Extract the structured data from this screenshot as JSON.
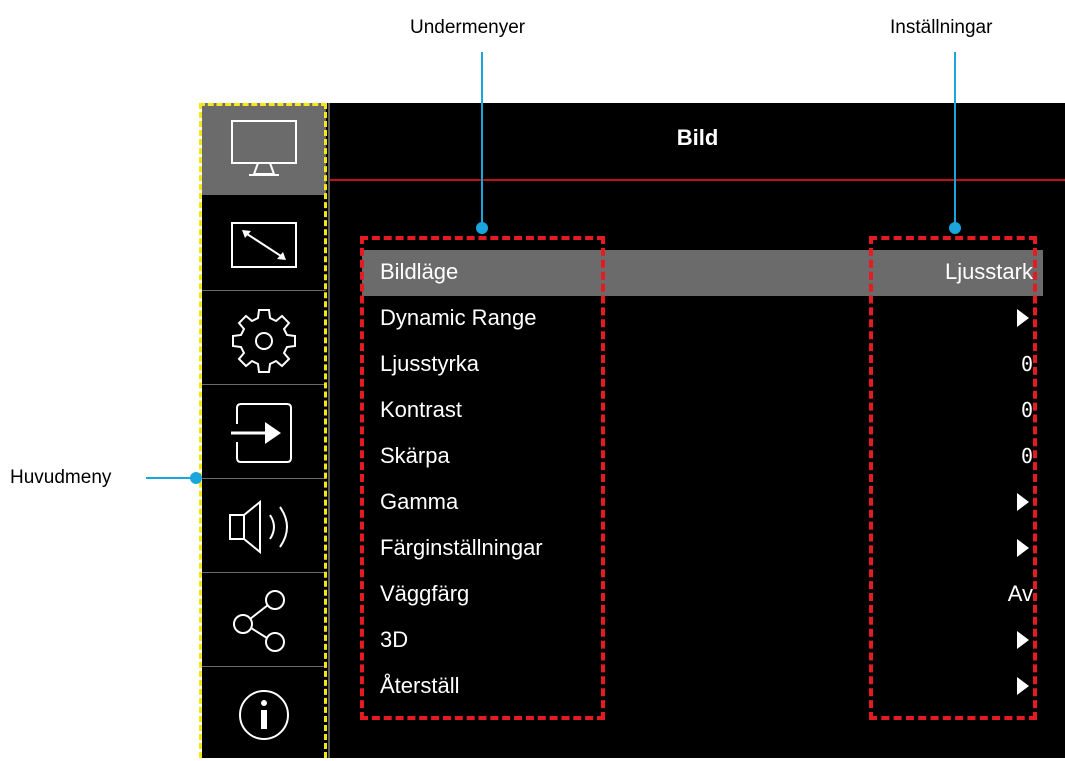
{
  "callouts": {
    "submenus": "Undermenyer",
    "settings": "Inställningar",
    "main_menu": "Huvudmeny"
  },
  "colors": {
    "callout": "#1aa6dc",
    "main_frame": "#f5e616",
    "group_frame": "#e51b23",
    "header_line": "#c0101a",
    "selected_row": "#6b6b6b"
  },
  "sidebar": {
    "items": [
      {
        "icon": "monitor-icon",
        "active": true
      },
      {
        "icon": "resize-icon",
        "active": false
      },
      {
        "icon": "gear-icon",
        "active": false
      },
      {
        "icon": "input-icon",
        "active": false
      },
      {
        "icon": "speaker-icon",
        "active": false
      },
      {
        "icon": "share-icon",
        "active": false
      },
      {
        "icon": "info-icon",
        "active": false
      }
    ]
  },
  "header": {
    "title": "Bild"
  },
  "menu": {
    "items": [
      {
        "label": "Bildläge",
        "value": "Ljusstark",
        "kind": "text",
        "selected": true
      },
      {
        "label": "Dynamic Range",
        "kind": "arrow"
      },
      {
        "label": "Ljusstyrka",
        "value": "0",
        "kind": "num"
      },
      {
        "label": "Kontrast",
        "value": "0",
        "kind": "num"
      },
      {
        "label": "Skärpa",
        "value": "0",
        "kind": "num"
      },
      {
        "label": "Gamma",
        "kind": "arrow"
      },
      {
        "label": "Färginställningar",
        "kind": "arrow"
      },
      {
        "label": "Väggfärg",
        "value": "Av",
        "kind": "text"
      },
      {
        "label": "3D",
        "kind": "arrow"
      },
      {
        "label": "Återställ",
        "kind": "arrow"
      }
    ]
  }
}
